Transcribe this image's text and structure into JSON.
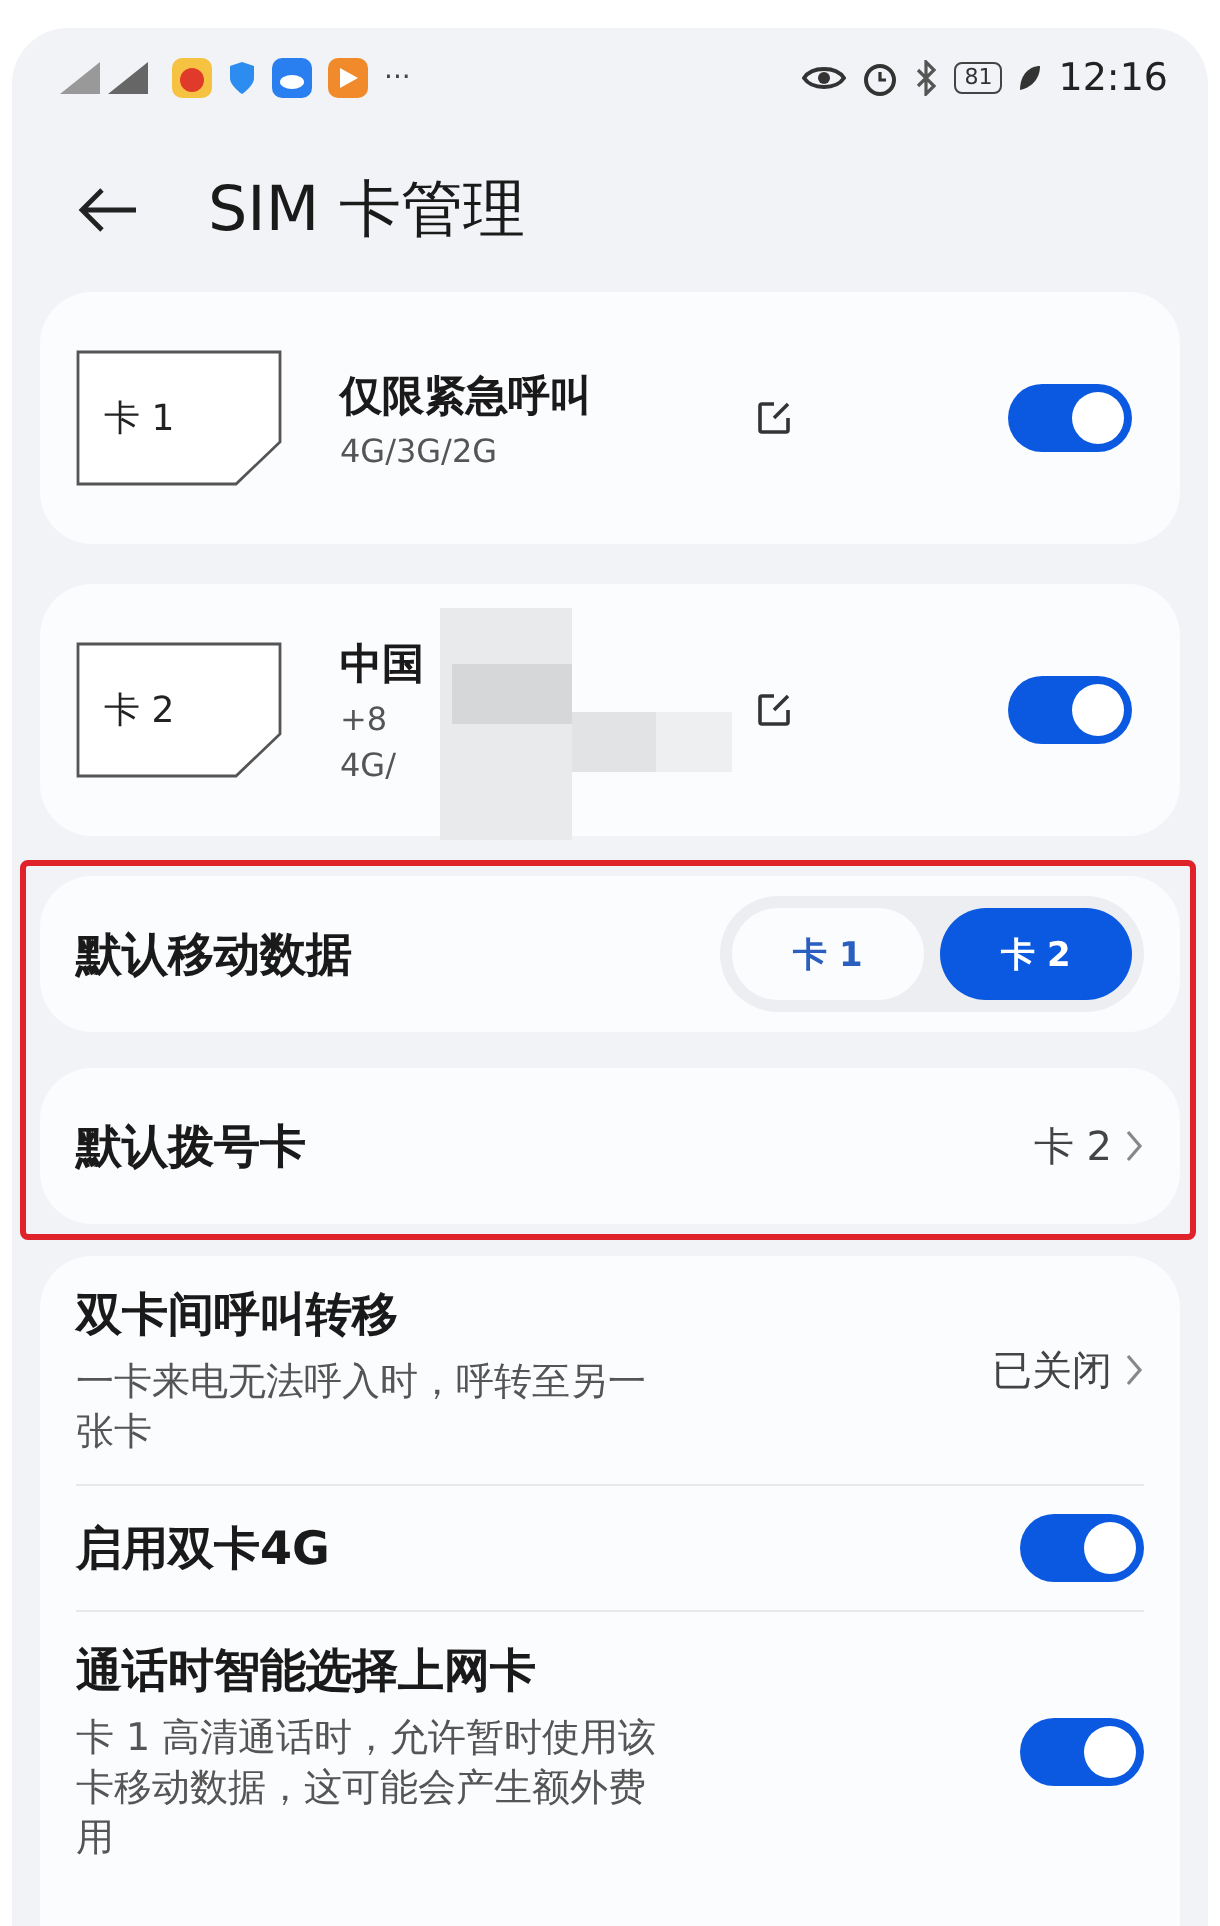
{
  "status_bar": {
    "battery": "81",
    "time": "12:16",
    "more": "···"
  },
  "header": {
    "title": "SIM 卡管理"
  },
  "sim_cards": [
    {
      "label": "卡 1",
      "name": "仅限紧急呼叫",
      "lines": [
        "4G/3G/2G"
      ],
      "enabled": true,
      "redacted": false
    },
    {
      "label": "卡 2",
      "name": "中国",
      "lines": [
        "+8",
        "4G/"
      ],
      "enabled": true,
      "redacted": true
    }
  ],
  "defaults": {
    "highlighted": true,
    "mobile_data": {
      "label": "默认移动数据",
      "options": [
        {
          "label": "卡 1",
          "selected": false
        },
        {
          "label": "卡 2",
          "selected": true
        }
      ]
    },
    "dial_card": {
      "label": "默认拨号卡",
      "value": "卡 2"
    }
  },
  "settings": [
    {
      "kind": "link",
      "title": "双卡间呼叫转移",
      "description": "一卡来电无法呼入时，呼转至另一张卡",
      "value": "已关闭"
    },
    {
      "kind": "toggle",
      "title": "启用双卡4G",
      "on": true
    },
    {
      "kind": "toggle",
      "title": "通话时智能选择上网卡",
      "description": "卡 1 高清通话时，允许暂时使用该卡移动数据，这可能会产生额外费用",
      "on": true
    }
  ]
}
